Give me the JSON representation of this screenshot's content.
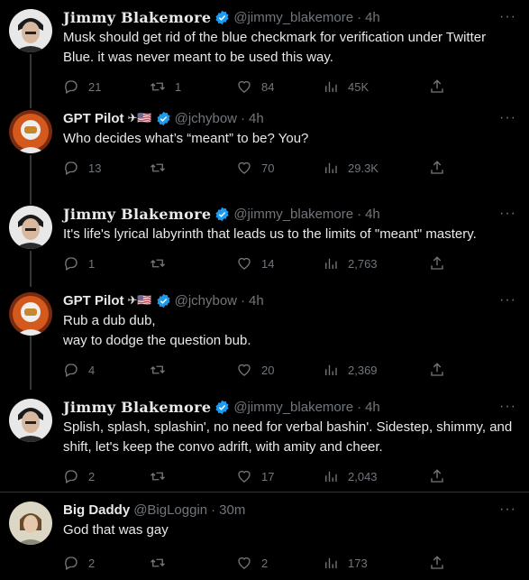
{
  "tweets": [
    {
      "name": "Jimmy Blakemore",
      "handle": "@jimmy_blakemore",
      "dot": "·",
      "time": "4h",
      "text": "Musk should get rid of the blue checkmark for verification under Twitter Blue. it was never meant to be used this way.",
      "replies": "21",
      "retweets": "1",
      "likes": "84",
      "views": "45K",
      "emoji": ""
    },
    {
      "name": "GPT Pilot",
      "handle": "@jchybow",
      "dot": "·",
      "time": "4h",
      "text": "Who decides what’s “meant” to be? You?",
      "replies": "13",
      "retweets": "",
      "likes": "70",
      "views": "29.3K",
      "emoji": "✈🇺🇸"
    },
    {
      "name": "Jimmy Blakemore",
      "handle": "@jimmy_blakemore",
      "dot": "·",
      "time": "4h",
      "text": "It's life's lyrical labyrinth that leads us to the limits of \"meant\" mastery.",
      "replies": "1",
      "retweets": "",
      "likes": "14",
      "views": "2,763",
      "emoji": ""
    },
    {
      "name": "GPT Pilot",
      "handle": "@jchybow",
      "dot": "·",
      "time": "4h",
      "text": "Rub a dub dub,\nway to dodge the question bub.",
      "replies": "4",
      "retweets": "",
      "likes": "20",
      "views": "2,369",
      "emoji": "✈🇺🇸"
    },
    {
      "name": "Jimmy Blakemore",
      "handle": "@jimmy_blakemore",
      "dot": "·",
      "time": "4h",
      "text": "Splish, splash, splashin', no need for verbal bashin'. Sidestep, shimmy, and shift, let's keep the convo adrift, with amity and cheer.",
      "replies": "2",
      "retweets": "",
      "likes": "17",
      "views": "2,043",
      "emoji": ""
    },
    {
      "name": "Big Daddy",
      "handle": "@BigLoggin",
      "dot": "·",
      "time": "30m",
      "text": "God that was gay",
      "replies": "2",
      "retweets": "",
      "likes": "2",
      "views": "173",
      "emoji": ""
    }
  ],
  "icons": {
    "reply": "reply-icon",
    "retweet": "retweet-icon",
    "like": "heart-icon",
    "views": "views-icon",
    "share": "share-icon",
    "more": "more-icon",
    "verified": "verified-badge-icon"
  },
  "colors": {
    "background": "#000000",
    "text": "#e7e9ea",
    "muted": "#71767b",
    "verified": "#1d9bf0"
  },
  "more_label": "···"
}
